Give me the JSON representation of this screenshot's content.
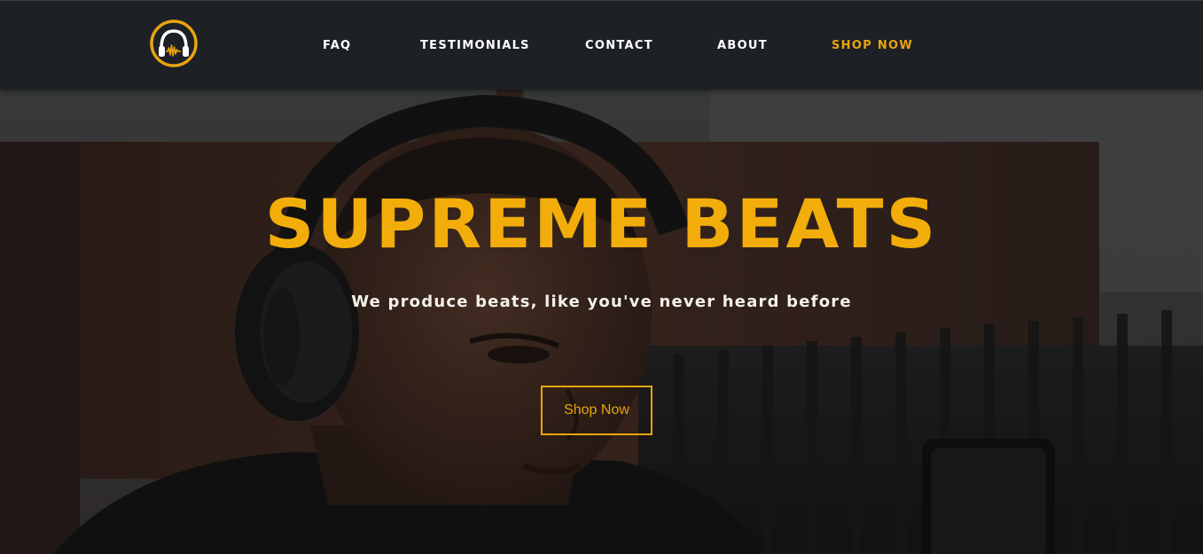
{
  "nav": {
    "logo_icon": "headphones-waveform-logo-icon",
    "links": [
      {
        "label": "FAQ"
      },
      {
        "label": "TESTIMONIALS"
      },
      {
        "label": "CONTACT"
      },
      {
        "label": "ABOUT"
      },
      {
        "label": "SHOP NOW",
        "active": true
      }
    ]
  },
  "hero": {
    "title": "SUPREME BEATS",
    "subtitle": "We produce beats, like you've never heard before",
    "button_label": "Shop Now",
    "image": "person-wearing-headphones-photo"
  },
  "colors": {
    "accent": "#e9a50c",
    "navbar_bg": "#1d2126",
    "text_light": "#ffffff"
  }
}
